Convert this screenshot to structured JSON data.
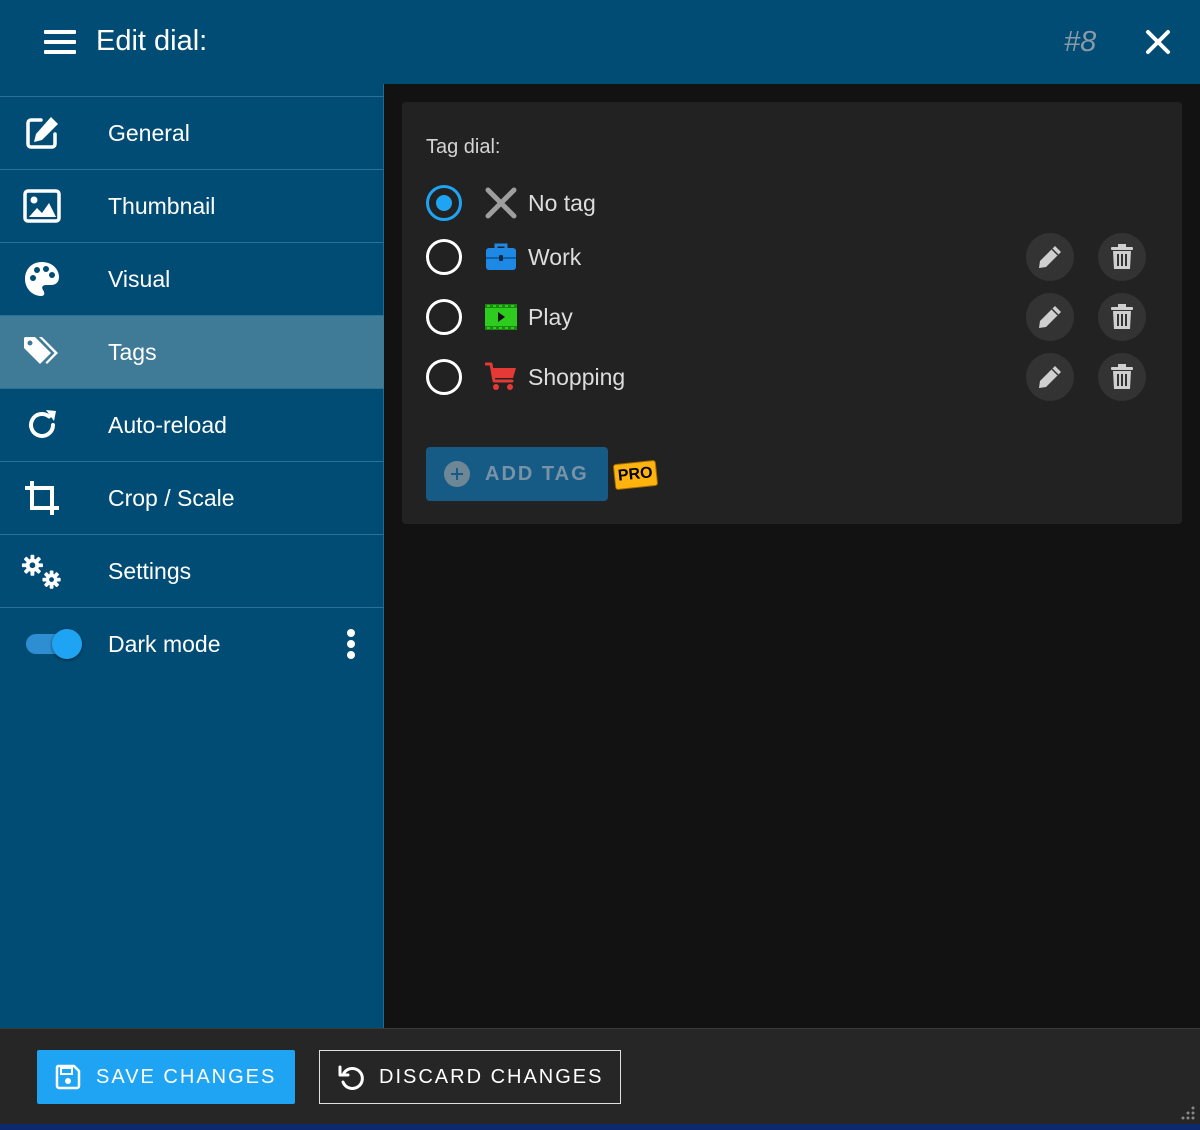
{
  "header": {
    "title": "Edit dial:",
    "dial_number": "#8",
    "menu_icon": "hamburger-icon",
    "close_icon": "close-icon"
  },
  "sidebar": {
    "items": [
      {
        "label": "General",
        "icon": "edit-icon"
      },
      {
        "label": "Thumbnail",
        "icon": "image-icon"
      },
      {
        "label": "Visual",
        "icon": "palette-icon"
      },
      {
        "label": "Tags",
        "icon": "tags-icon",
        "active": true
      },
      {
        "label": "Auto-reload",
        "icon": "reload-icon"
      },
      {
        "label": "Crop / Scale",
        "icon": "crop-icon"
      },
      {
        "label": "Settings",
        "icon": "gears-icon"
      }
    ],
    "dark_mode": {
      "label": "Dark mode",
      "enabled": true
    }
  },
  "tags_panel": {
    "title": "Tag dial:",
    "options": [
      {
        "label": "No tag",
        "icon": "x-icon",
        "selected": true,
        "color": "#9e9e9e"
      },
      {
        "label": "Work",
        "icon": "briefcase-icon",
        "selected": false,
        "color": "#1e88e5"
      },
      {
        "label": "Play",
        "icon": "film-icon",
        "selected": false,
        "color": "#2ecc1f"
      },
      {
        "label": "Shopping",
        "icon": "cart-icon",
        "selected": false,
        "color": "#e53935"
      }
    ],
    "add_tag_label": "ADD TAG",
    "pro_badge": "PRO"
  },
  "footer": {
    "save_label": "SAVE CHANGES",
    "discard_label": "DISCARD CHANGES"
  },
  "colors": {
    "accent": "#1ea4f3",
    "sidebar": "#004c75",
    "active_item": "#3f7a97",
    "panel": "#222222",
    "background": "#121212"
  }
}
